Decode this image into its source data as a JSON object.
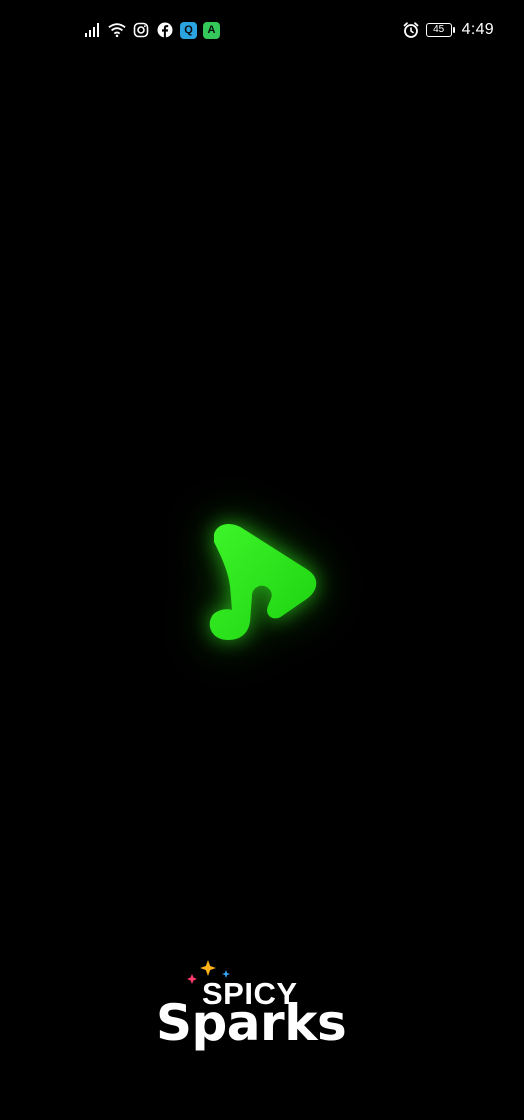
{
  "status_bar": {
    "icons_left": [
      "signal-icon",
      "wifi-icon",
      "instagram-icon",
      "facebook-icon",
      "q-app-icon",
      "a-app-icon"
    ],
    "q_badge": "Q",
    "a_badge": "A",
    "battery": "45",
    "time": "4:49",
    "colors": {
      "q_badge": "#2aa3e0",
      "a_badge": "#34c759"
    }
  },
  "splash": {
    "logo_icon": "music-note-play-icon",
    "logo_color": "#2fe61e"
  },
  "brand": {
    "top": "SPICY",
    "bottom": "Sparks",
    "sparkle_colors": [
      "#ff3c6e",
      "#ffb21c",
      "#33a8ff"
    ]
  }
}
